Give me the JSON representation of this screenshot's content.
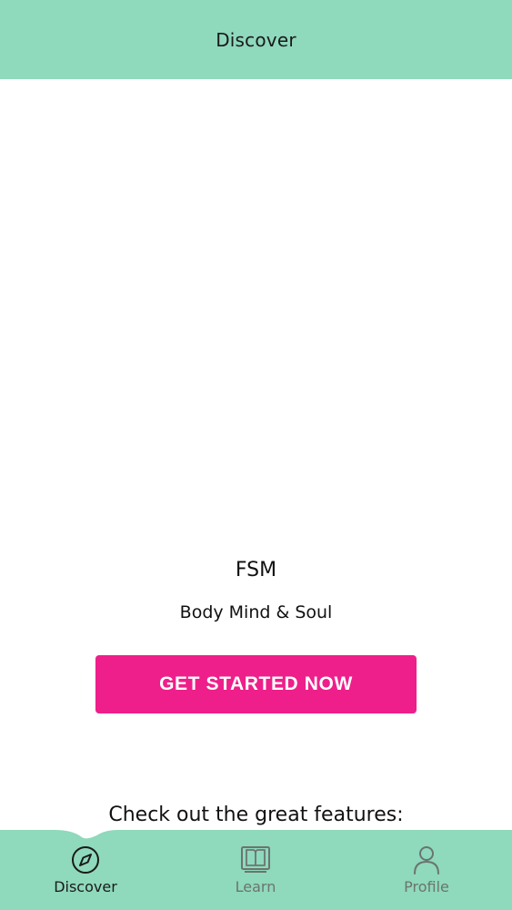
{
  "header": {
    "title": "Discover"
  },
  "hero": {
    "app_name": "FSM",
    "tagline": "Body Mind & Soul",
    "cta_label": "GET STARTED NOW"
  },
  "features": {
    "heading": "Check out the great features:"
  },
  "bottom_nav": {
    "items": [
      {
        "label": "Discover",
        "icon": "compass-icon",
        "active": true
      },
      {
        "label": "Learn",
        "icon": "book-icon",
        "active": false
      },
      {
        "label": "Profile",
        "icon": "person-icon",
        "active": false
      }
    ]
  },
  "colors": {
    "header_bg": "#8fd9bc",
    "nav_bg": "#8fd9bc",
    "cta_bg": "#ee1f8a",
    "cta_text": "#ffffff",
    "active": "#1a1a1a",
    "inactive": "#6a7570"
  }
}
